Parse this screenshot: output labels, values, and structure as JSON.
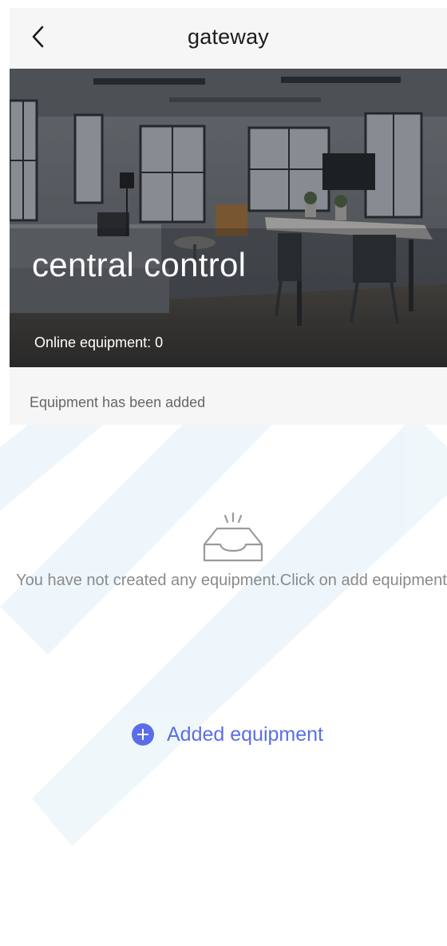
{
  "header": {
    "title": "gateway",
    "back_icon": "chevron-left-icon"
  },
  "hero": {
    "title": "central control",
    "online_label": "Online equipment:",
    "online_count": "0"
  },
  "section": {
    "label": "Equipment has been added"
  },
  "empty_state": {
    "icon": "empty-inbox-icon",
    "message": "You have not created any equipment.Click on add equipment"
  },
  "actions": {
    "add_icon": "plus-circle-icon",
    "add_label": "Added equipment"
  },
  "colors": {
    "accent": "#5b6ee8",
    "header_bg": "#f6f6f6",
    "muted_text": "#8a8a8a"
  }
}
